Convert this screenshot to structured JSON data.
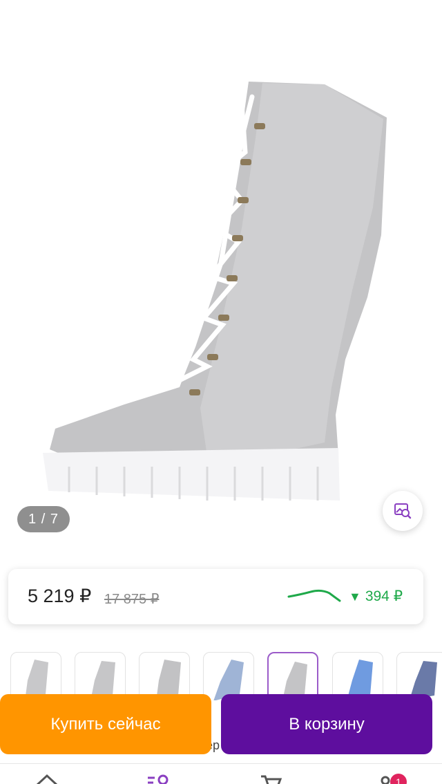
{
  "gallery": {
    "counter": "1 / 7",
    "product_image": "grey-felt-lace-up-boot"
  },
  "price": {
    "current": "5 219 ₽",
    "old": "17 875 ₽",
    "drop": "394 ₽",
    "drop_icon": "down-triangle",
    "graph_color": "#1fa94a"
  },
  "thumbnails": {
    "count_visible": 7,
    "active_index": 4
  },
  "actions": {
    "buy_now": "Купить сейчас",
    "add_to_cart": "В корзину"
  },
  "peek_text": "ер",
  "tabbar": {
    "icons": [
      "home-icon",
      "catalog-search-icon",
      "cart-icon",
      "profile-icon"
    ],
    "profile_badge": "1"
  },
  "colors": {
    "buy_button": "#ff9500",
    "cart_button": "#5e0e9e",
    "active_thumb_border": "#9b5bc9"
  }
}
